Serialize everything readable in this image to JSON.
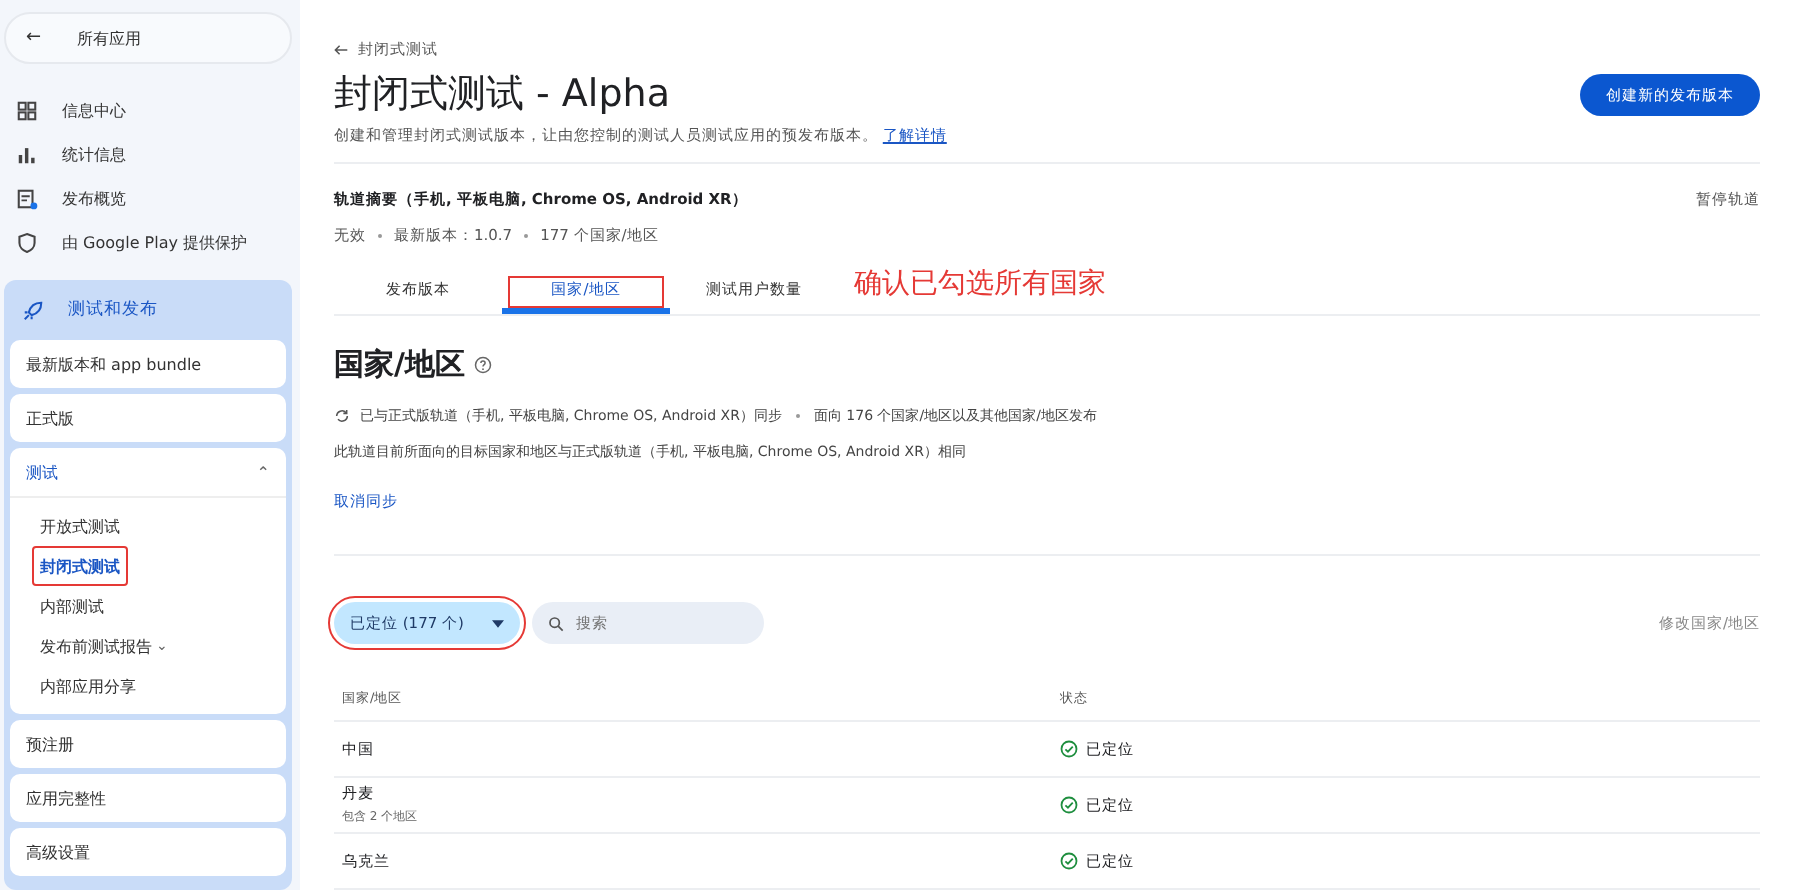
{
  "sidebar": {
    "back": {
      "icon": "←",
      "label": "所有应用"
    },
    "nav": [
      {
        "label": "信息中心"
      },
      {
        "label": "统计信息"
      },
      {
        "label": "发布概览"
      },
      {
        "label": "由 Google Play 提供保护"
      }
    ],
    "section": {
      "label": "测试和发布",
      "items": [
        {
          "label": "最新版本和 app bundle",
          "selected": false
        },
        {
          "label": "正式版",
          "selected": false
        },
        {
          "label": "测试",
          "expanded": true,
          "selected": true,
          "caret": "⌃",
          "children": [
            {
              "label": "开放式测试",
              "selected": false,
              "highlighted": false
            },
            {
              "label": "封闭式测试",
              "selected": true,
              "highlighted": true
            },
            {
              "label": "内部测试",
              "selected": false,
              "highlighted": false
            },
            {
              "label": "发布前测试报告",
              "selected": false,
              "highlighted": false,
              "caret": "⌄"
            },
            {
              "label": "内部应用分享",
              "selected": false,
              "highlighted": false
            }
          ]
        },
        {
          "label": "预注册",
          "selected": false
        },
        {
          "label": "应用完整性",
          "selected": false
        },
        {
          "label": "高级设置",
          "selected": false
        }
      ]
    }
  },
  "header": {
    "breadcrumb": "封闭式测试",
    "title": "封闭式测试 - Alpha",
    "description": "创建和管理封闭式测试版本，让由您控制的测试人员测试应用的预发布版本。",
    "learn_more": "了解详情",
    "primary_button": "创建新的发布版本"
  },
  "track": {
    "summary": "轨道摘要（手机, 平板电脑, Chrome OS, Android XR）",
    "pause": "暂停轨道",
    "meta": [
      "无效",
      "最新版本：1.0.7",
      "177 个国家/地区"
    ]
  },
  "tabs": [
    {
      "label": "发布版本",
      "selected": false,
      "highlighted": false
    },
    {
      "label": "国家/地区",
      "selected": true,
      "highlighted": true
    },
    {
      "label": "测试用户数量",
      "selected": false,
      "highlighted": false
    }
  ],
  "annotation": "确认已勾选所有国家",
  "countries": {
    "heading": "国家/地区",
    "sync_parts": [
      "已与正式版轨道（手机, 平板电脑, Chrome OS, Android XR）同步",
      "面向 176 个国家/地区以及其他国家/地区发布"
    ],
    "note": "此轨道目前所面向的目标国家和地区与正式版轨道（手机, 平板电脑, Chrome OS, Android XR）相同",
    "unsync": "取消同步",
    "filter": {
      "label": "已定位 (177 个)",
      "highlighted": true
    },
    "search": {
      "placeholder": "搜索"
    },
    "edit": "修改国家/地区",
    "table": {
      "columns": [
        "国家/地区",
        "状态"
      ],
      "rows": [
        {
          "name": "中国",
          "status": "已定位",
          "targeted": true
        },
        {
          "name": "丹麦",
          "sub": "包含 2 个地区",
          "status": "已定位",
          "targeted": true
        },
        {
          "name": "乌克兰",
          "status": "已定位",
          "targeted": true
        }
      ]
    }
  }
}
